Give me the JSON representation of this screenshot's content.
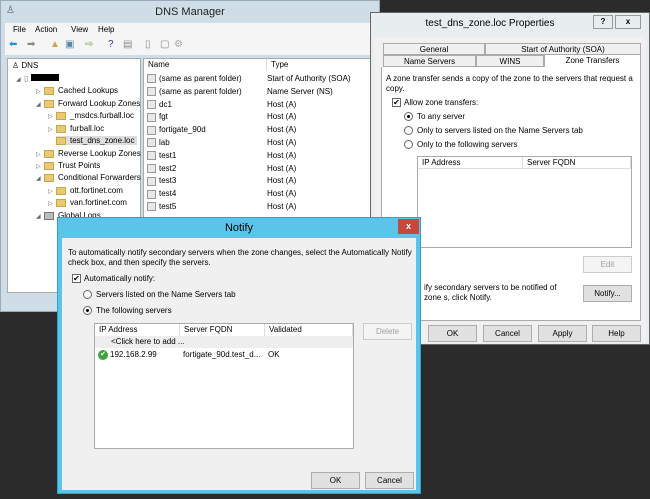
{
  "dns_manager": {
    "title": "DNS Manager",
    "menu": [
      "File",
      "Action",
      "View",
      "Help"
    ],
    "tree": [
      {
        "label": "DNS",
        "level": 0
      },
      {
        "label": "",
        "level": 1,
        "redacted": true
      },
      {
        "label": "Cached Lookups",
        "level": 2
      },
      {
        "label": "Forward Lookup Zones",
        "level": 2
      },
      {
        "label": "_msdcs.furball.loc",
        "level": 3
      },
      {
        "label": "furball.loc",
        "level": 3
      },
      {
        "label": "test_dns_zone.loc",
        "level": 3,
        "selected": true
      },
      {
        "label": "Reverse Lookup Zones",
        "level": 2
      },
      {
        "label": "Trust Points",
        "level": 2
      },
      {
        "label": "Conditional Forwarders",
        "level": 2
      },
      {
        "label": "ott.fortinet.com",
        "level": 3
      },
      {
        "label": "van.fortinet.com",
        "level": 3
      },
      {
        "label": "Global Logs",
        "level": 2
      }
    ],
    "columns": [
      "Name",
      "Type"
    ],
    "records": [
      [
        "(same as parent folder)",
        "Start of Authority (SOA)"
      ],
      [
        "(same as parent folder)",
        "Name Server (NS)"
      ],
      [
        "dc1",
        "Host (A)"
      ],
      [
        "fgt",
        "Host (A)"
      ],
      [
        "fortigate_90d",
        "Host (A)"
      ],
      [
        "lab",
        "Host (A)"
      ],
      [
        "test1",
        "Host (A)"
      ],
      [
        "test2",
        "Host (A)"
      ],
      [
        "test3",
        "Host (A)"
      ],
      [
        "test4",
        "Host (A)"
      ],
      [
        "test5",
        "Host (A)"
      ]
    ]
  },
  "properties": {
    "title": "test_dns_zone.loc Properties",
    "help": "?",
    "close": "x",
    "tabs_row1": [
      "General",
      "Start of Authority (SOA)"
    ],
    "tabs_row2": [
      "Name Servers",
      "WINS",
      "Zone Transfers"
    ],
    "description": "A zone transfer sends a copy of the zone to the servers that request a copy.",
    "allow_label": "Allow zone transfers:",
    "allow_checked": true,
    "options": [
      "To any server",
      "Only to servers listed on the Name Servers tab",
      "Only to the following servers"
    ],
    "selected_option": 0,
    "columns": [
      "IP Address",
      "Server FQDN"
    ],
    "edit": "Edit",
    "notify_text": "ify secondary servers to be notified of zone s, click Notify.",
    "notify_button": "Notify...",
    "buttons": [
      "OK",
      "Cancel",
      "Apply",
      "Help"
    ]
  },
  "notify": {
    "title": "Notify",
    "close": "x",
    "description": "To automatically notify secondary servers when the zone changes, select the Automatically Notify check box, and then specify the servers.",
    "auto_label": "Automatically notify:",
    "auto_checked": true,
    "options": [
      "Servers listed on the Name Servers tab",
      "The following servers"
    ],
    "selected_option": 1,
    "columns": [
      "IP Address",
      "Server FQDN",
      "Validated"
    ],
    "add_row": "<Click here to add ...",
    "rows": [
      [
        "192.168.2.99",
        "fortigate_90d.test_d...",
        "OK"
      ]
    ],
    "delete": "Delete",
    "ok": "OK",
    "cancel": "Cancel"
  },
  "colors": {
    "accent": "#5bc4e8",
    "close_red": "#c7463d"
  }
}
